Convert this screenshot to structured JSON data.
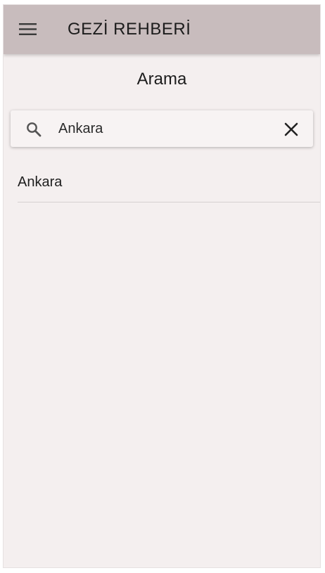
{
  "appbar": {
    "title": "GEZİ REHBERİ",
    "menu_icon": "hamburger-menu-icon"
  },
  "page": {
    "title": "Arama"
  },
  "search": {
    "value": "Ankara",
    "search_icon": "search-icon",
    "clear_icon": "close-icon"
  },
  "results": [
    {
      "label": "Ankara"
    }
  ],
  "colors": {
    "appbar_bg": "#c8bcbd",
    "page_bg": "#f4efef",
    "text": "#1c1c1c",
    "divider": "#d6d0d0"
  }
}
